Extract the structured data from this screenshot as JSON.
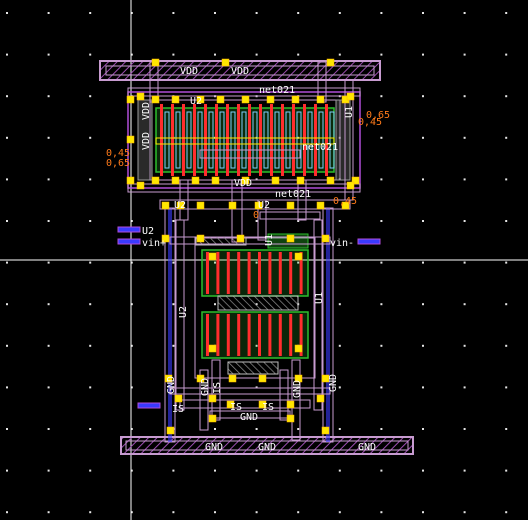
{
  "colors": {
    "background": "#000000",
    "grid_dot": "#e6e6e6",
    "axis": "#ffffff",
    "rail_outline": "#c79bd0",
    "rail_hatch": "#9b4db0",
    "metal1": "#3a3aff",
    "poly": "#ff2d2d",
    "diffusion": "#2dbf2d",
    "contact": "#ffe600",
    "nwell": "#b04dd8",
    "label_text": "#ffffff",
    "value_text": "#ff7a1a"
  },
  "labels": {
    "vdd1": "VDD",
    "vdd2": "VDD",
    "vdd_left_a": "VDD",
    "vdd_left_b": "VDD",
    "vdd_mid": "VDD",
    "u2_top": "U2",
    "u2_mid": "U2",
    "u2_left": "U2",
    "u2_vert": "U2",
    "u1_vert": "U1",
    "u1_mid": "U1",
    "net_top": "net021",
    "net_mid": "net021",
    "net_mid2": "net021",
    "vin_plus": "vin+",
    "vin_minus": "vin-",
    "gnd_rail1": "GND",
    "gnd_rail2": "GND",
    "gnd_rail3": "GND",
    "gnd_mid": "GND",
    "gnd_v1": "GND",
    "gnd_v2": "GND",
    "gnd_v3": "GND",
    "is1": "IS",
    "is2": "IS",
    "is3": "IS",
    "is_v": "IS",
    "dim_045_left": "0,45",
    "dim_065_left": "0,65",
    "dim_065_right": "0,65",
    "dim_045_right": "0,45",
    "dim_045_mid": "0,45",
    "dim_0_mid": "0"
  }
}
